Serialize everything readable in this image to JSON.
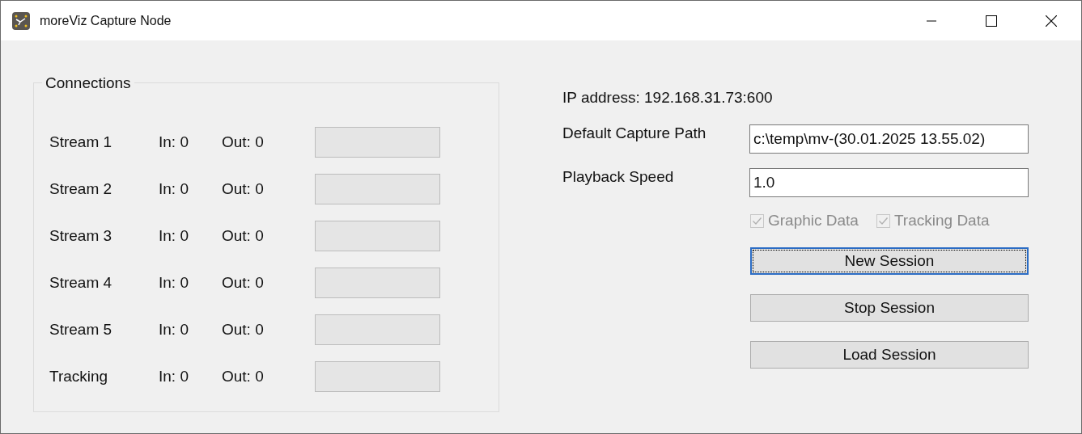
{
  "window": {
    "title": "moreViz Capture Node"
  },
  "connections": {
    "title": "Connections",
    "rows": [
      {
        "name": "Stream 1",
        "in": "In: 0",
        "out": "Out: 0"
      },
      {
        "name": "Stream 2",
        "in": "In: 0",
        "out": "Out: 0"
      },
      {
        "name": "Stream 3",
        "in": "In: 0",
        "out": "Out: 0"
      },
      {
        "name": "Stream 4",
        "in": "In: 0",
        "out": "Out: 0"
      },
      {
        "name": "Stream 5",
        "in": "In: 0",
        "out": "Out: 0"
      },
      {
        "name": "Tracking",
        "in": "In: 0",
        "out": "Out: 0"
      }
    ]
  },
  "ip_address": "IP address: 192.168.31.73:600",
  "fields": [
    {
      "label": "Default Capture Path",
      "value": "c:\\temp\\mv-(30.01.2025 13.55.02)"
    },
    {
      "label": "Playback Speed",
      "value": "1.0"
    }
  ],
  "checkboxes": [
    {
      "label": "Graphic Data",
      "checked": true,
      "disabled": true
    },
    {
      "label": "Tracking Data",
      "checked": true,
      "disabled": true
    }
  ],
  "buttons": [
    {
      "label": "New Session",
      "focused": true
    },
    {
      "label": "Stop Session",
      "focused": false
    },
    {
      "label": "Load Session",
      "focused": false
    }
  ]
}
